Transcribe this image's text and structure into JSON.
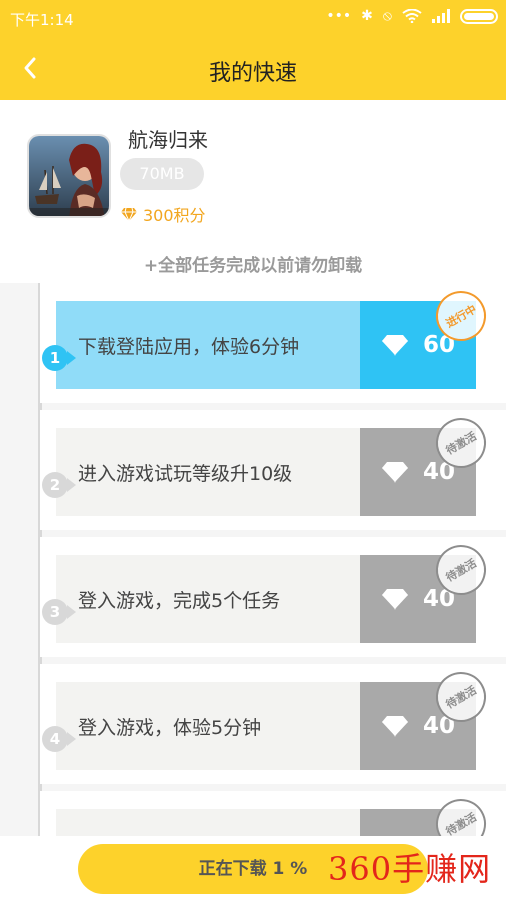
{
  "status_bar": {
    "time": "下午1:14"
  },
  "header": {
    "title": "我的快速"
  },
  "app": {
    "name": "航海归来",
    "size": "70MB",
    "points": "300积分"
  },
  "notice": "+全部任务完成以前请勿卸载",
  "tasks": [
    {
      "step": "1",
      "title": "下载登陆应用，体验6分钟",
      "reward": "60",
      "status": "进行中",
      "active": true
    },
    {
      "step": "2",
      "title": "进入游戏试玩等级升10级",
      "reward": "40",
      "status": "待激活",
      "active": false
    },
    {
      "step": "3",
      "title": "登入游戏，完成5个任务",
      "reward": "40",
      "status": "待激活",
      "active": false
    },
    {
      "step": "4",
      "title": "登入游戏，体验5分钟",
      "reward": "40",
      "status": "待激活",
      "active": false
    },
    {
      "step": "",
      "title": "",
      "reward": "",
      "status": "待激活",
      "active": false
    }
  ],
  "download_button": {
    "label": "正在下载 1 %"
  },
  "watermark": "360手赚网",
  "colors": {
    "primary": "#fdd22b",
    "active": "#2fc3f4",
    "active_light": "#90dcf8",
    "inactive": "#a9a9a9",
    "points": "#f2a61f",
    "watermark": "#e3261b"
  }
}
